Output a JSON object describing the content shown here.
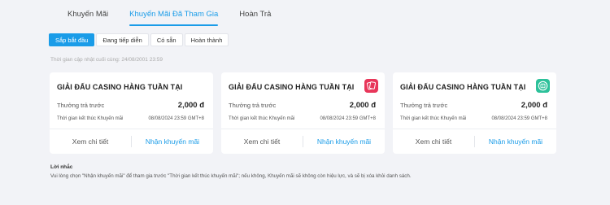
{
  "tabs": [
    {
      "label": "Khuyến Mãi",
      "active": false
    },
    {
      "label": "Khuyến Mãi Đã Tham Gia",
      "active": true
    },
    {
      "label": "Hoàn Trả",
      "active": false
    }
  ],
  "filters": [
    {
      "label": "Sắp bắt đầu",
      "active": true
    },
    {
      "label": "Đang tiếp diễn",
      "active": false
    },
    {
      "label": "Có sẵn",
      "active": false
    },
    {
      "label": "Hoàn thành",
      "active": false
    }
  ],
  "updated_text": "Thời gian cập nhật cuối cùng: 24/08/2001 23:59",
  "cards": [
    {
      "title": "GIẢI ĐẤU CASINO HÀNG TUẦN TẠI",
      "icon": "none",
      "reward_label": "Thưởng trả trước",
      "reward_value": "2,000 đ",
      "end_label": "Thời gian kết thúc Khuyến mãi",
      "end_value": "08/08/2024 23:59 GMT+8",
      "detail_label": "Xem chi tiết",
      "claim_label": "Nhận khuyến mãi"
    },
    {
      "title": "GIẢI ĐẤU CASINO HÀNG TUẦN TẠI",
      "icon": "cards-icon",
      "reward_label": "Thưởng trả trước",
      "reward_value": "2,000 đ",
      "end_label": "Thời gian kết thúc Khuyến mãi",
      "end_value": "08/08/2024 23:59 GMT+8",
      "detail_label": "Xem chi tiết",
      "claim_label": "Nhận khuyến mãi"
    },
    {
      "title": "GIẢI ĐẤU CASINO HÀNG TUẦN TẠI",
      "icon": "slot-icon",
      "reward_label": "Thưởng trả trước",
      "reward_value": "2,000 đ",
      "end_label": "Thời gian kết thúc Khuyến mãi",
      "end_value": "08/08/2024 23:59 GMT+8",
      "detail_label": "Xem chi tiết",
      "claim_label": "Nhận khuyến mãi"
    }
  ],
  "note": {
    "title": "Lời nhắc",
    "text": "Vui lòng chọn \"Nhận khuyến mãi\" để tham gia trước \"Thời gian kết thúc khuyến mãi\"; nếu không, Khuyến mãi sẽ không còn hiệu lực, và sẽ bị xóa khỏi danh sách."
  },
  "colors": {
    "accent": "#1a9ce8",
    "background": "#f2f3f7",
    "cards_icon_bg": "#e8365a",
    "slot_icon_bg": "#2dc19a"
  }
}
